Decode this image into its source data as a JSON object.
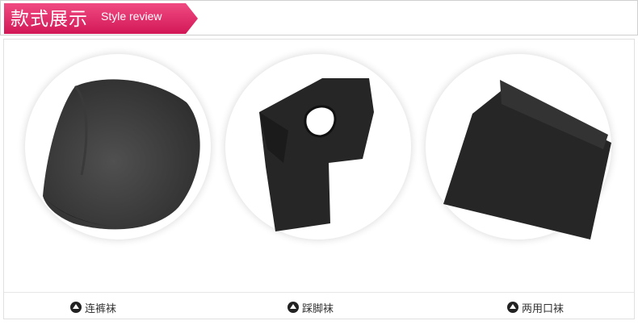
{
  "header": {
    "title": "款式展示",
    "subtitle": "Style review",
    "accent_color": "#e0225f"
  },
  "items": [
    {
      "label": "连裤袜",
      "icon": "triangle-up-circle-icon"
    },
    {
      "label": "踩脚袜",
      "icon": "triangle-up-circle-icon"
    },
    {
      "label": "两用口袜",
      "icon": "triangle-up-circle-icon"
    }
  ]
}
